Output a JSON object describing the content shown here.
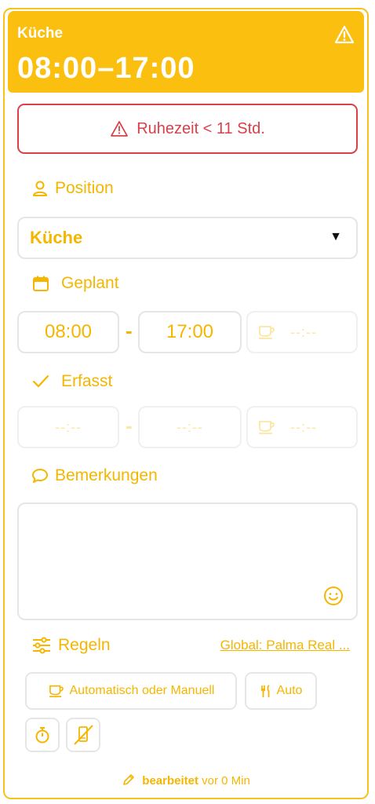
{
  "colors": {
    "accent": "#fbbf10",
    "accent_text": "#f5b600",
    "danger": "#d9404a",
    "border": "#e6e6e6"
  },
  "header": {
    "position": "Küche",
    "time": "08:00–17:00",
    "icon": "warning-icon"
  },
  "alert": {
    "text": "Ruhezeit < 11 Std.",
    "icon": "warning-icon"
  },
  "position_section": {
    "label": "Position",
    "icon": "user-icon",
    "selected": "Küche"
  },
  "planned": {
    "label": "Geplant",
    "icon": "calendar-icon",
    "start": "08:00",
    "separator": "-",
    "end": "17:00",
    "break": "--:--"
  },
  "recorded": {
    "label": "Erfasst",
    "icon": "check-icon",
    "start": "--:--",
    "separator": "-",
    "end": "--:--",
    "break": "--:--"
  },
  "remarks": {
    "label": "Bemerkungen",
    "icon": "comment-icon",
    "value": ""
  },
  "rules": {
    "label": "Regeln",
    "icon": "sliders-icon",
    "global_link": "Global: Palma Real ...",
    "break_mode": "Automatisch oder Manuell",
    "meal_mode": "Auto"
  },
  "footer": {
    "bold": "bearbeitet",
    "rest": "vor 0 Min"
  }
}
